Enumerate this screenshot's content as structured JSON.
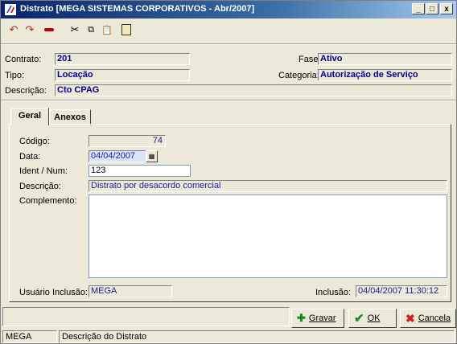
{
  "window": {
    "title": "Distrato [MEGA SISTEMAS CORPORATIVOS - Abr/2007]",
    "min": "_",
    "max": "□",
    "close": "x"
  },
  "header": {
    "contrato_label": "Contrato:",
    "contrato_value": "201",
    "tipo_label": "Tipo:",
    "tipo_value": "Locação",
    "descricao_label": "Descrição:",
    "descricao_value": "Cto CPAG",
    "fase_label": "Fase:",
    "fase_value": "Ativo",
    "categoria_label": "Categoria:",
    "categoria_value": "Autorização de Serviço"
  },
  "tabs": [
    {
      "label": "Geral"
    },
    {
      "label": "Anexos"
    }
  ],
  "form": {
    "codigo_label": "Código:",
    "codigo_value": "74",
    "data_label": "Data:",
    "data_value": "04/04/2007",
    "ident_label": "Ident / Num:",
    "ident_value": "123",
    "descricao_label": "Descrição:",
    "descricao_value": "Distrato por desacordo comercial",
    "complemento_label": "Complemento:",
    "complemento_value": "",
    "usuario_label": "Usuário Inclusão:",
    "usuario_value": "MEGA",
    "inclusao_label": "Inclusão:",
    "inclusao_value": "04/04/2007 11:30:12"
  },
  "buttons": {
    "gravar": "Gravar",
    "ok": "OK",
    "cancelar": "Cancela"
  },
  "status": {
    "user": "MEGA",
    "message": "Descrição do Distrato"
  },
  "colors": {
    "title_start": "#0a246a",
    "value_text": "#00008b",
    "face": "#ECE9D8"
  }
}
